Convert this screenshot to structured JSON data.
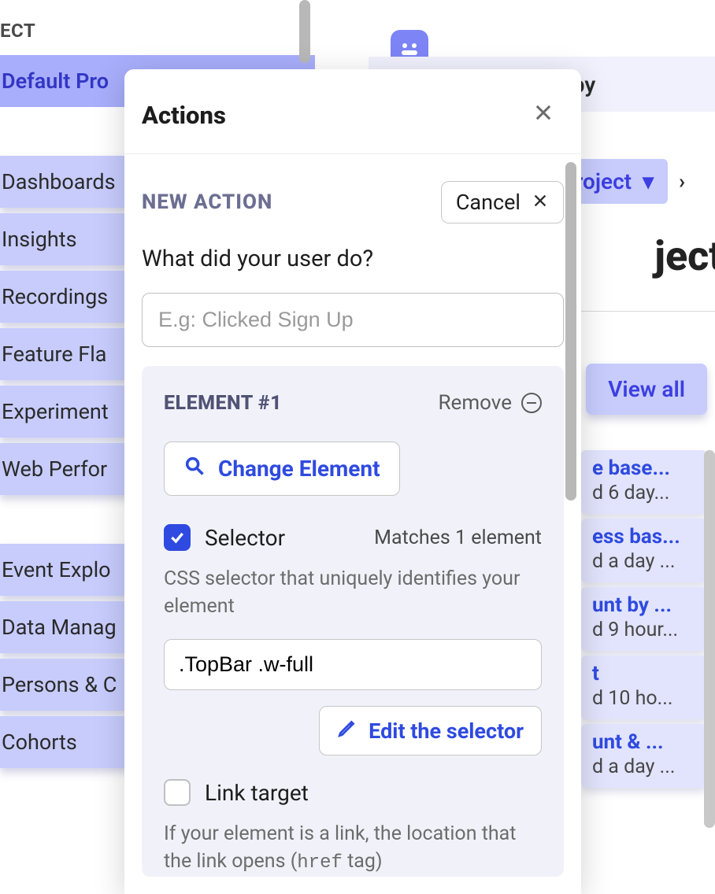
{
  "sidebar": {
    "heading": "ECT",
    "items": [
      {
        "label": "Default Pro",
        "selected": true
      },
      {
        "label": "Dashboards"
      },
      {
        "label": "Insights"
      },
      {
        "label": "Recordings"
      },
      {
        "label": "Feature Fla"
      },
      {
        "label": "Experiment"
      },
      {
        "label": "Web Perfor"
      },
      {
        "label": "Event Explo"
      },
      {
        "label": "Data Manag"
      },
      {
        "label": "Persons & C"
      },
      {
        "label": "Cohorts"
      }
    ]
  },
  "background": {
    "banner_text": "of PostHog by",
    "breadcrumb_pill": "roject",
    "big_title": "ject",
    "view_all": "View all",
    "cards": [
      {
        "title": "e base...",
        "sub": "d 6 day..."
      },
      {
        "title": "ess bas...",
        "sub": "d a day ..."
      },
      {
        "title": "unt by ...",
        "sub": "d 9 hour..."
      },
      {
        "title": "t",
        "sub": "d 10 ho..."
      },
      {
        "title": "unt & ...",
        "sub": "d a day ..."
      }
    ]
  },
  "modal": {
    "title": "Actions",
    "section_label": "NEW ACTION",
    "cancel": "Cancel",
    "question": "What did your user do?",
    "name_placeholder": "E.g: Clicked Sign Up",
    "element": {
      "title": "ELEMENT #1",
      "remove": "Remove",
      "change_button": "Change Element",
      "selector_label": "Selector",
      "match_text": "Matches 1 element",
      "selector_help": "CSS selector that uniquely identifies your element",
      "selector_value": ".TopBar .w-full",
      "edit_selector": "Edit the selector",
      "link_target_label": "Link target",
      "link_target_help_pre": "If your element is a link, the location that the link opens (",
      "link_target_help_code": "href",
      "link_target_help_post": " tag)"
    }
  }
}
